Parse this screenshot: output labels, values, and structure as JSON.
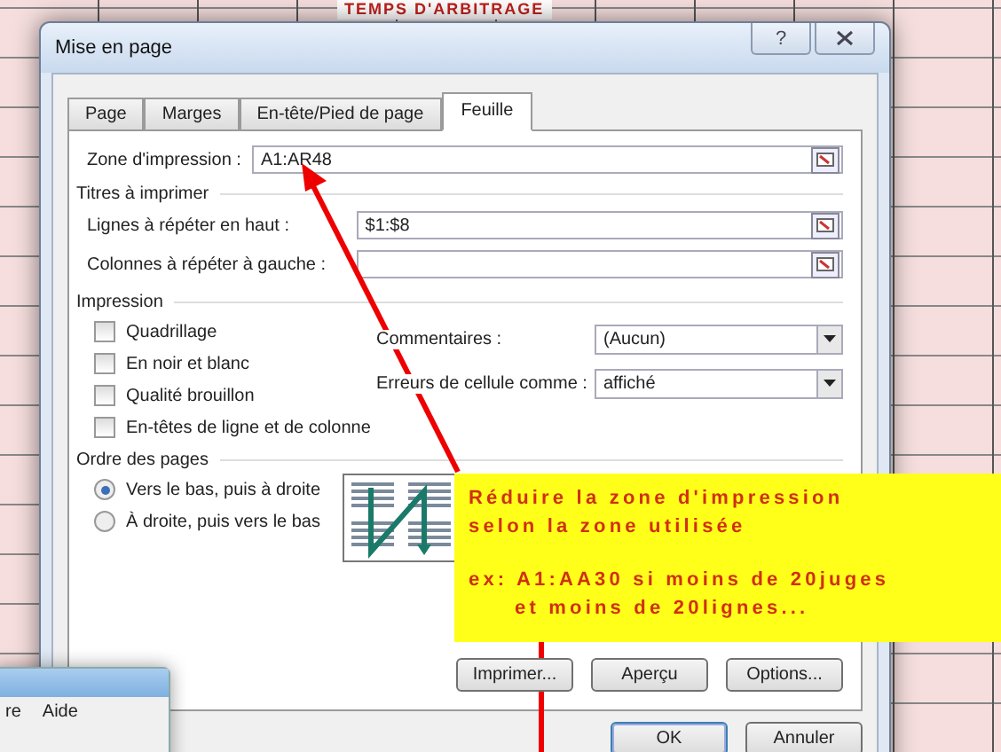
{
  "sheet": {
    "header": "TEMPS D'ARBITRAGE"
  },
  "back_window": {
    "menu": [
      "re",
      "Aide"
    ]
  },
  "dialog": {
    "title": "Mise en page",
    "help": "?",
    "tabs": [
      {
        "label": "Page",
        "selected": false
      },
      {
        "label": "Marges",
        "selected": false
      },
      {
        "label": "En-tête/Pied de page",
        "selected": false
      },
      {
        "label": "Feuille",
        "selected": true
      }
    ],
    "print_area": {
      "label": "Zone d'impression :",
      "value": "A1:AR48"
    },
    "titles": {
      "heading": "Titres à imprimer",
      "rows": [
        {
          "label": "Lignes à répéter en haut :",
          "value": "$1:$8"
        },
        {
          "label": "Colonnes à répéter à gauche :"
        }
      ]
    },
    "print": {
      "heading": "Impression",
      "options": [
        {
          "label": "Quadrillage",
          "checked": false
        },
        {
          "label": "En noir et blanc",
          "checked": false
        },
        {
          "label": "Qualité brouillon",
          "checked": false
        },
        {
          "label": "En-têtes de ligne et de colonne",
          "checked": false
        }
      ],
      "selects": [
        {
          "label": "Commentaires :",
          "value": "(Aucun)"
        },
        {
          "label": "Erreurs de cellule comme :",
          "value": "affiché"
        }
      ]
    },
    "order": {
      "heading": "Ordre des pages",
      "options": [
        {
          "label": "Vers le bas, puis à droite",
          "selected": true
        },
        {
          "label": "À droite, puis vers le bas",
          "selected": false
        }
      ]
    },
    "action_buttons": [
      "Imprimer...",
      "Aperçu",
      "Options..."
    ],
    "buttons": [
      "OK",
      "Annuler"
    ]
  },
  "note": {
    "lines": [
      "Réduire la zone d'impression",
      "selon la zone utilisée",
      "ex: A1:AA30 si moins de 20juges",
      "et moins de 20lignes..."
    ]
  }
}
